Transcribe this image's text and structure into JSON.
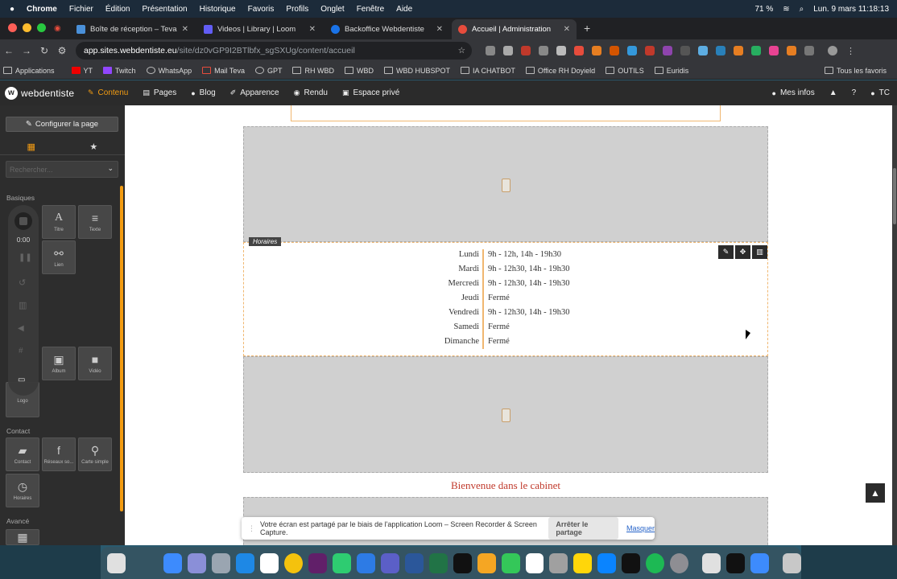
{
  "menubar": {
    "app": "Chrome",
    "items": [
      "Fichier",
      "Édition",
      "Présentation",
      "Historique",
      "Favoris",
      "Profils",
      "Onglet",
      "Fenêtre",
      "Aide"
    ],
    "battery": "71 %",
    "datetime": "Lun. 9 mars  11:18:13"
  },
  "tabs": [
    {
      "title": "Boîte de réception – Teva Cla",
      "color": "#4a90d9"
    },
    {
      "title": "Videos | Library | Loom",
      "color": "#625df5"
    },
    {
      "title": "Backoffice Webdentiste",
      "color": "#1a73e8"
    },
    {
      "title": "Accueil | Administration",
      "color": "#e74c3c"
    }
  ],
  "address": {
    "host": "app.sites.webdentiste.eu",
    "path": "/site/dz0vGP9I2BTlbfx_sgSXUg/content/accueil"
  },
  "bookmarks": [
    "Applications",
    "YT",
    "Twitch",
    "WhatsApp",
    "Mail Teva",
    "GPT",
    "RH WBD",
    "WBD",
    "WBD HUBSPOT",
    "IA CHATBOT",
    "Office RH Doyield",
    "OUTILS",
    "Euridis"
  ],
  "bookmarks_right": "Tous les favoris",
  "app": {
    "logo": "webdentiste",
    "nav": [
      "Contenu",
      "Pages",
      "Blog",
      "Apparence",
      "Rendu",
      "Espace privé"
    ],
    "right": [
      "Mes infos",
      "?",
      "TC"
    ]
  },
  "sidebar": {
    "configure": "Configurer la page",
    "search_placeholder": "Rechercher...",
    "sections": {
      "basic": "Basiques",
      "contact": "Contact",
      "advanced": "Avancé"
    },
    "blocks": {
      "titre": "Titre",
      "texte": "Texte",
      "lien": "Lien",
      "album": "Album",
      "video": "Vidéo",
      "logo": "Logo",
      "contact": "Contact",
      "reseaux": "Réseaux so...",
      "carte": "Carte simple",
      "horaires": "Horaires"
    },
    "recorder_time": "0:00"
  },
  "hours": {
    "tag": "Horaires",
    "rows": [
      {
        "day": "Lundi",
        "value": "9h - 12h, 14h - 19h30"
      },
      {
        "day": "Mardi",
        "value": "9h - 12h30, 14h - 19h30"
      },
      {
        "day": "Mercredi",
        "value": "9h - 12h30, 14h - 19h30"
      },
      {
        "day": "Jeudi",
        "value": "Fermé"
      },
      {
        "day": "Vendredi",
        "value": "9h - 12h30, 14h - 19h30"
      },
      {
        "day": "Samedi",
        "value": "Fermé"
      },
      {
        "day": "Dimanche",
        "value": "Fermé"
      }
    ]
  },
  "welcome": "Bienvenue dans le cabinet",
  "loom": {
    "message": "Votre écran est partagé par le biais de l'application Loom – Screen Recorder & Screen Capture.",
    "stop": "Arrêter le partage",
    "hide": "Masquer"
  },
  "colors": {
    "accent": "#f39c12",
    "welcome": "#c0392b"
  }
}
